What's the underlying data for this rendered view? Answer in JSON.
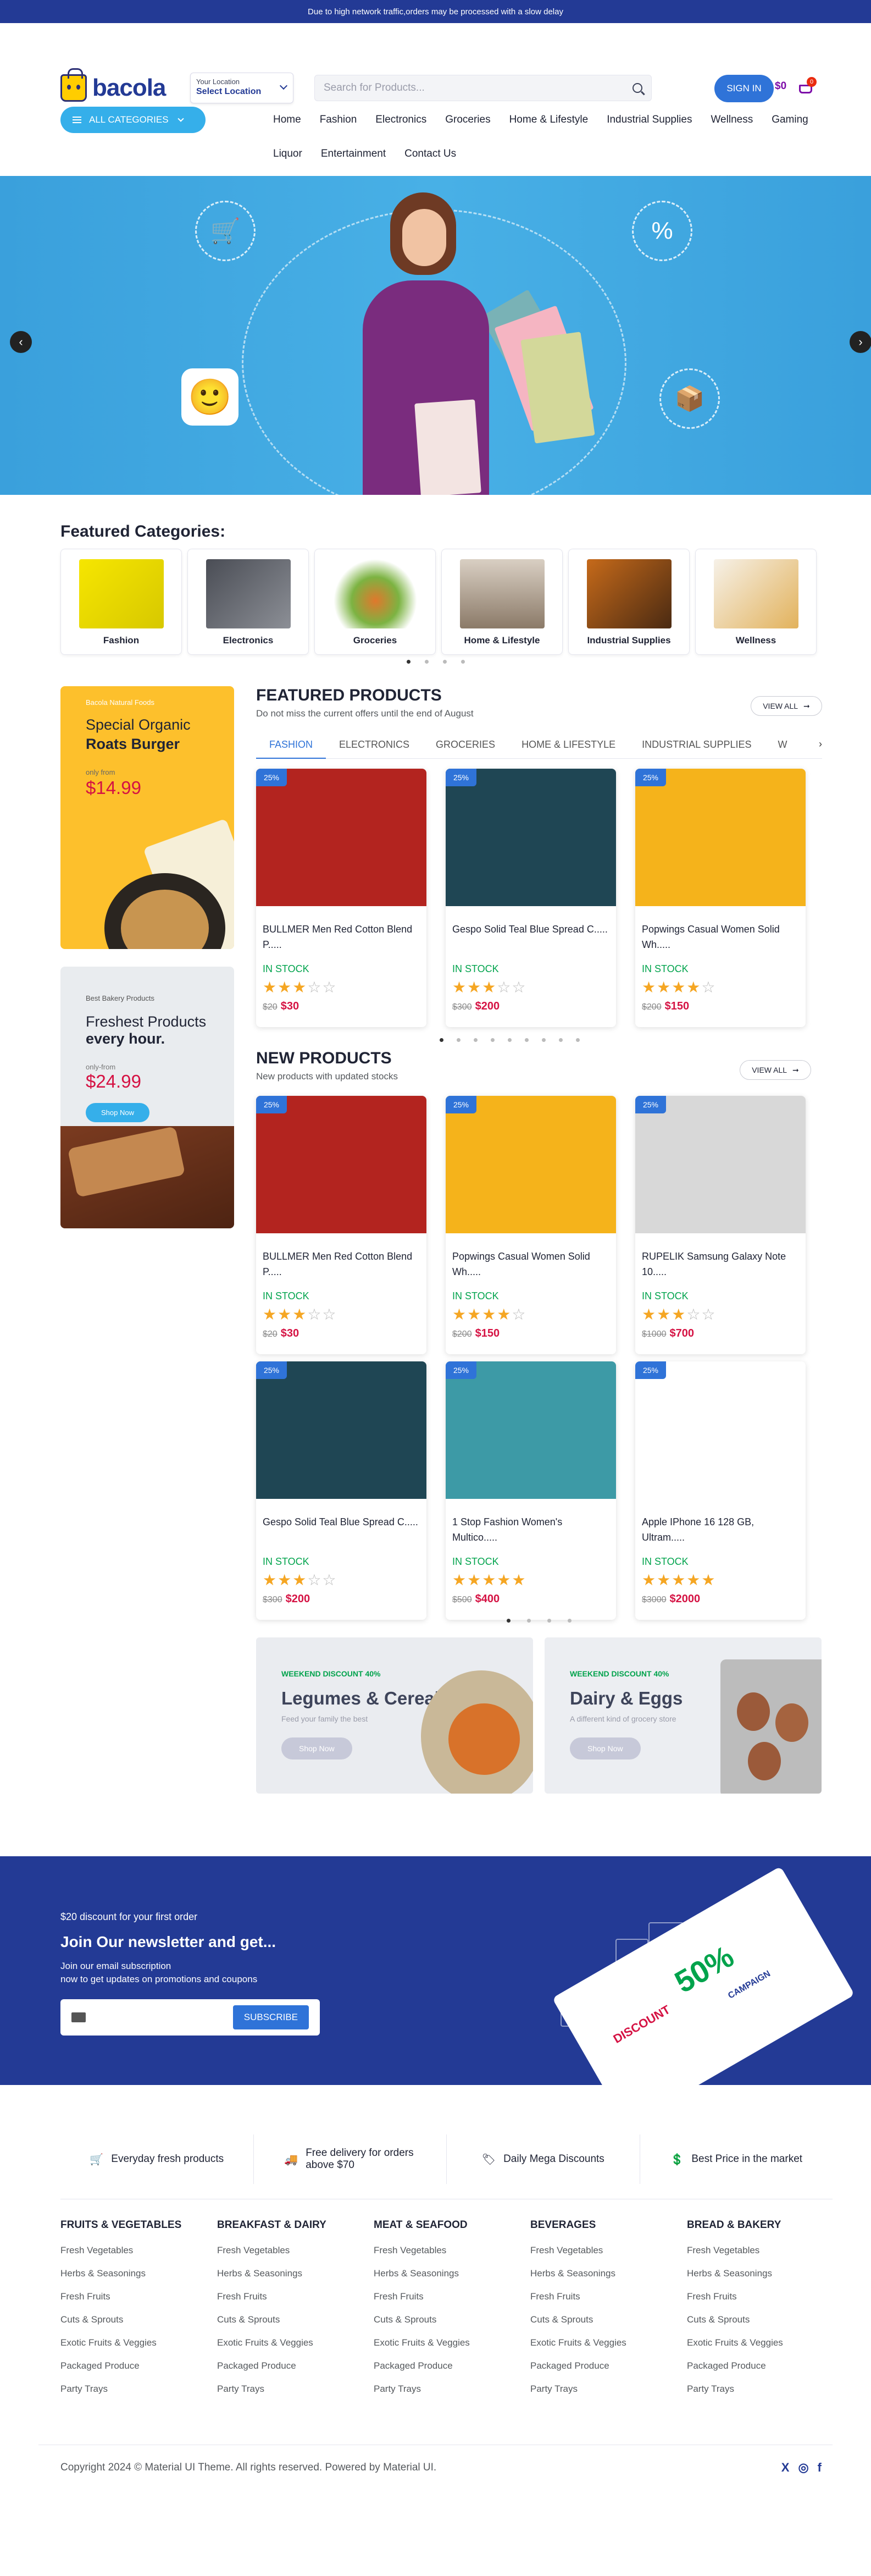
{
  "topbar": {
    "text": "Due to high network traffic,orders may be processed with a slow delay"
  },
  "header": {
    "logo_text": "bacola",
    "location_label": "Your Location",
    "location_value": "Select Location",
    "search_placeholder": "Search for Products...",
    "signin_label": "SIGN IN",
    "cart_total": "$0",
    "cart_count": "0"
  },
  "nav": {
    "all_categories": "ALL CATEGORIES",
    "items": [
      "Home",
      "Fashion",
      "Electronics",
      "Groceries",
      "Home & Lifestyle",
      "Industrial Supplies",
      "Wellness",
      "Gaming",
      "Liquor",
      "Entertainment",
      "Contact Us"
    ]
  },
  "hero": {
    "prev": "‹",
    "next": "›"
  },
  "featured_categories": {
    "title": "Featured Categories:",
    "items": [
      "Fashion",
      "Electronics",
      "Groceries",
      "Home & Lifestyle",
      "Industrial Supplies",
      "Wellness"
    ]
  },
  "banner1": {
    "tag": "Bacola Natural Foods",
    "line1": "Special Organic",
    "line2": "Roats Burger",
    "only_from": "only from",
    "price": "$14.99"
  },
  "banner2": {
    "tag": "Best Bakery Products",
    "line1": "Freshest Products",
    "line2": "every hour.",
    "only_from": "only-from",
    "price": "$24.99",
    "button": "Shop Now"
  },
  "featured_products": {
    "title": "FEATURED PRODUCTS",
    "subtitle": "Do not miss the current offers until the end of August",
    "view_all": "VIEW ALL",
    "tabs": [
      "FASHION",
      "ELECTRONICS",
      "GROCERIES",
      "HOME & LIFESTYLE",
      "INDUSTRIAL SUPPLIES",
      "W"
    ],
    "products": [
      {
        "discount": "25%",
        "name": "BULLMER Men Red Cotton Blend P.....",
        "stock": "IN STOCK",
        "rating": 3,
        "old_price": "$20",
        "price": "$30",
        "color": "#b3241f"
      },
      {
        "discount": "25%",
        "name": "Gespo Solid Teal Blue Spread C.....",
        "stock": "IN STOCK",
        "rating": 3,
        "old_price": "$300",
        "price": "$200",
        "color": "#1f4654"
      },
      {
        "discount": "25%",
        "name": "Popwings Casual Women Solid Wh.....",
        "stock": "IN STOCK",
        "rating": 4,
        "old_price": "$200",
        "price": "$150",
        "color": "#f5b31b"
      }
    ]
  },
  "new_products": {
    "title": "NEW PRODUCTS",
    "subtitle": "New products with updated stocks",
    "view_all": "VIEW ALL",
    "products": [
      {
        "discount": "25%",
        "name": "BULLMER Men Red Cotton Blend P.....",
        "stock": "IN STOCK",
        "rating": 3,
        "old_price": "$20",
        "price": "$30",
        "color": "#b3241f"
      },
      {
        "discount": "25%",
        "name": "Popwings Casual Women Solid Wh.....",
        "stock": "IN STOCK",
        "rating": 4,
        "old_price": "$200",
        "price": "$150",
        "color": "#f5b31b"
      },
      {
        "discount": "25%",
        "name": "RUPELIK Samsung Galaxy Note 10.....",
        "stock": "IN STOCK",
        "rating": 3,
        "old_price": "$1000",
        "price": "$700",
        "color": "#d8d8d8"
      },
      {
        "discount": "25%",
        "name": "Gespo Solid Teal Blue Spread C.....",
        "stock": "IN STOCK",
        "rating": 3,
        "old_price": "$300",
        "price": "$200",
        "color": "#1f4654"
      },
      {
        "discount": "25%",
        "name": "1 Stop Fashion Women's Multico.....",
        "stock": "IN STOCK",
        "rating": 5,
        "old_price": "$500",
        "price": "$400",
        "color": "#3d9aa6"
      },
      {
        "discount": "25%",
        "name": "Apple IPhone 16 128 GB, Ultram.....",
        "stock": "IN STOCK",
        "rating": 5,
        "old_price": "$3000",
        "price": "$2000",
        "color": "#ffffff"
      }
    ]
  },
  "promos": [
    {
      "tag": "WEEKEND DISCOUNT 40%",
      "title": "Legumes & Cereals",
      "desc": "Feed your family the best",
      "button": "Shop Now"
    },
    {
      "tag": "WEEKEND DISCOUNT 40%",
      "title": "Dairy & Eggs",
      "desc": "A different kind of grocery store",
      "button": "Shop Now"
    }
  ],
  "newsletter": {
    "discount": "$20 discount for your first order",
    "title": "Join Our newsletter and get...",
    "desc1": "Join our email subscription",
    "desc2": "now to get updates on promotions and coupons",
    "button": "SUBSCRIBE",
    "coupon_percent": "50%",
    "coupon_word": "DISCOUNT",
    "coupon_campaign": "CAMPAIGN"
  },
  "features": [
    "Everyday fresh products",
    "Free delivery for orders above $70",
    "Daily Mega Discounts",
    "Best Price in the market"
  ],
  "footer_columns": [
    {
      "heading": "FRUITS & VEGETABLES",
      "links": [
        "Fresh Vegetables",
        "Herbs & Seasonings",
        "Fresh Fruits",
        "Cuts & Sprouts",
        "Exotic Fruits & Veggies",
        "Packaged Produce",
        "Party Trays"
      ]
    },
    {
      "heading": "BREAKFAST & DAIRY",
      "links": [
        "Fresh Vegetables",
        "Herbs & Seasonings",
        "Fresh Fruits",
        "Cuts & Sprouts",
        "Exotic Fruits & Veggies",
        "Packaged Produce",
        "Party Trays"
      ]
    },
    {
      "heading": "MEAT & SEAFOOD",
      "links": [
        "Fresh Vegetables",
        "Herbs & Seasonings",
        "Fresh Fruits",
        "Cuts & Sprouts",
        "Exotic Fruits & Veggies",
        "Packaged Produce",
        "Party Trays"
      ]
    },
    {
      "heading": "BEVERAGES",
      "links": [
        "Fresh Vegetables",
        "Herbs & Seasonings",
        "Fresh Fruits",
        "Cuts & Sprouts",
        "Exotic Fruits & Veggies",
        "Packaged Produce",
        "Party Trays"
      ]
    },
    {
      "heading": "BREAD & BAKERY",
      "links": [
        "Fresh Vegetables",
        "Herbs & Seasonings",
        "Fresh Fruits",
        "Cuts & Sprouts",
        "Exotic Fruits & Veggies",
        "Packaged Produce",
        "Party Trays"
      ]
    }
  ],
  "footer": {
    "copyright": "Copyright 2024 © Material UI Theme. All rights reserved. Powered by Material UI.",
    "social_icons": [
      "x-icon",
      "instagram-icon",
      "facebook-icon"
    ]
  },
  "colors": {
    "primary": "#233a95",
    "accent": "#2f73d8",
    "sky": "#35afea",
    "price": "#d51243",
    "stock": "#00a34c",
    "star": "#f5a623"
  }
}
